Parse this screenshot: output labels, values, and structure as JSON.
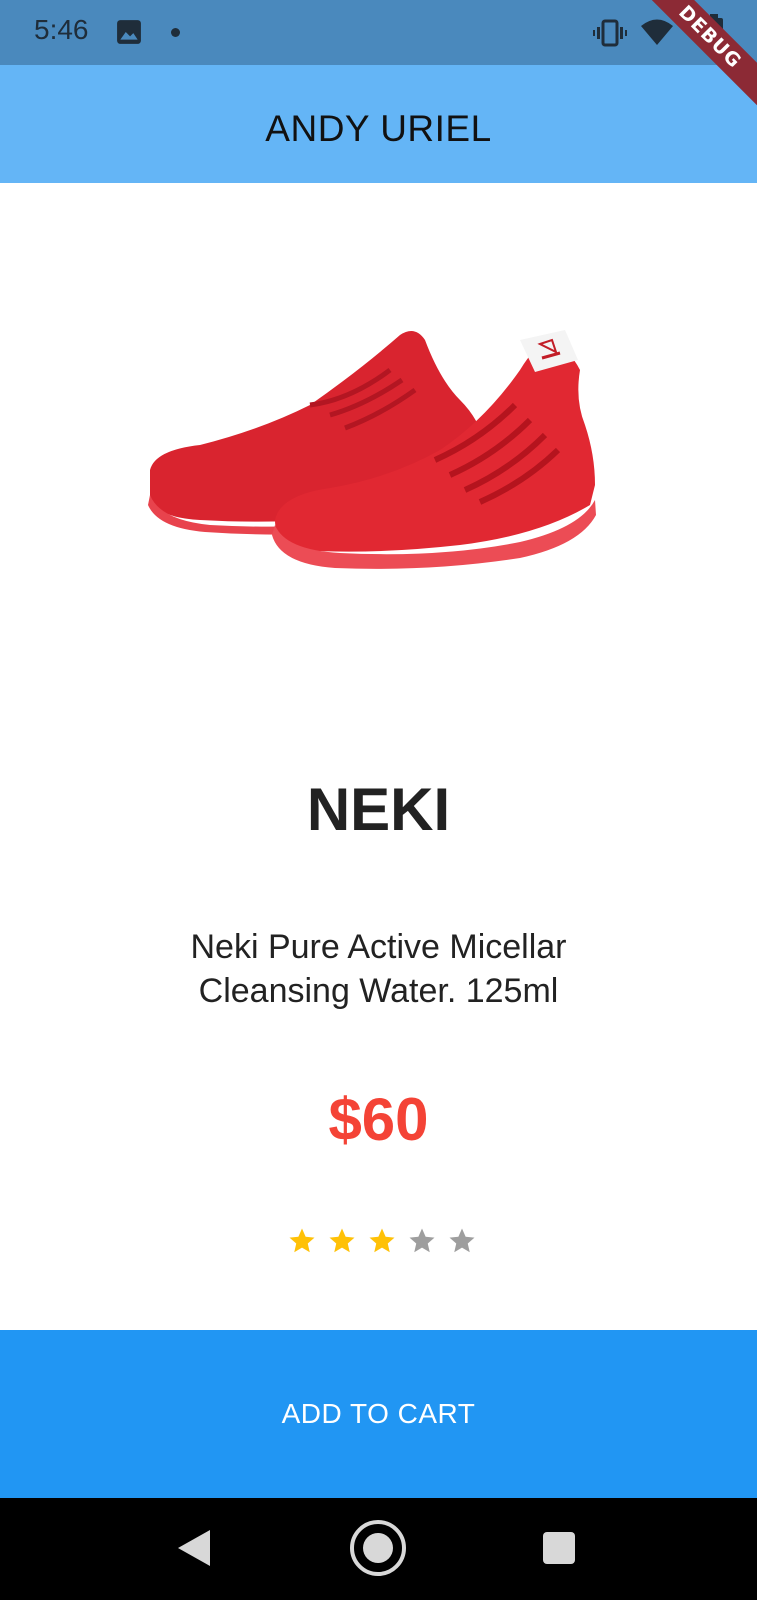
{
  "status_bar": {
    "time": "5:46",
    "icons": [
      "image-icon",
      "notification-dot",
      "vibrate-icon",
      "wifi-icon",
      "battery-icon"
    ],
    "debug_label": "DEBUG"
  },
  "app_bar": {
    "title": "ANDY URIEL"
  },
  "product": {
    "image": "red-sneakers-image",
    "name": "NEKI",
    "description": "Neki Pure Active Micellar Cleansing Water. 125ml",
    "price": "$60",
    "rating": 3,
    "rating_max": 5
  },
  "actions": {
    "add_to_cart_label": "ADD TO CART"
  },
  "nav_bar": {
    "icons": [
      "back-icon",
      "home-icon",
      "recents-icon"
    ]
  },
  "colors": {
    "status_bar": "#4a89bd",
    "app_bar": "#64b5f6",
    "price": "#f44336",
    "button": "#2196f3",
    "star_filled": "#ffc107",
    "star_empty": "#9e9e9e",
    "debug_ribbon": "#8c2a35"
  }
}
